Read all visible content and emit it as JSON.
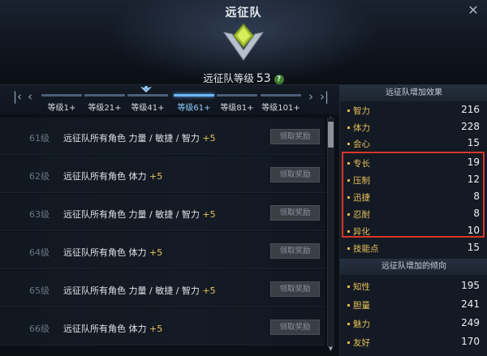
{
  "window": {
    "title": "远征队",
    "close_icon": "close-icon"
  },
  "header": {
    "level_label": "远征队等级",
    "level_value": "53",
    "help": "?"
  },
  "tabs": [
    {
      "label": "等级1+",
      "active": false
    },
    {
      "label": "等级21+",
      "active": false
    },
    {
      "label": "等级41+",
      "active": false
    },
    {
      "label": "等级61+",
      "active": true
    },
    {
      "label": "等级81+",
      "active": false
    },
    {
      "label": "等级101+",
      "active": false
    }
  ],
  "rewards": [
    {
      "level": "61级",
      "desc": "远征队所有角色 力量 / 敏捷 / 智力",
      "bonus": "+5",
      "button": "领取奖励"
    },
    {
      "level": "62级",
      "desc": "远征队所有角色 体力",
      "bonus": "+5",
      "button": "领取奖励"
    },
    {
      "level": "63级",
      "desc": "远征队所有角色 力量 / 敏捷 / 智力",
      "bonus": "+5",
      "button": "领取奖励"
    },
    {
      "level": "64级",
      "desc": "远征队所有角色 体力",
      "bonus": "+5",
      "button": "领取奖励"
    },
    {
      "level": "65级",
      "desc": "远征队所有角色 力量 / 敏捷 / 智力",
      "bonus": "+5",
      "button": "领取奖励"
    },
    {
      "level": "66级",
      "desc": "远征队所有角色 体力",
      "bonus": "+5",
      "button": "领取奖励"
    }
  ],
  "effects": {
    "title": "远征队增加效果",
    "stats": [
      {
        "name": "智力",
        "value": "216"
      },
      {
        "name": "体力",
        "value": "228"
      },
      {
        "name": "会心",
        "value": "15"
      },
      {
        "name": "专长",
        "value": "19"
      },
      {
        "name": "压制",
        "value": "12"
      },
      {
        "name": "迅捷",
        "value": "8"
      },
      {
        "name": "忍耐",
        "value": "8"
      },
      {
        "name": "异化",
        "value": "10"
      },
      {
        "name": "技能点",
        "value": "15"
      }
    ]
  },
  "tendency": {
    "title": "远征队增加的倾向",
    "stats": [
      {
        "name": "知性",
        "value": "195"
      },
      {
        "name": "胆量",
        "value": "241"
      },
      {
        "name": "魅力",
        "value": "249"
      },
      {
        "name": "友好",
        "value": "170"
      }
    ]
  },
  "colors": {
    "highlight": "#d8362a",
    "accent": "#6ab7ff",
    "stat_label": "#e7c15a"
  }
}
